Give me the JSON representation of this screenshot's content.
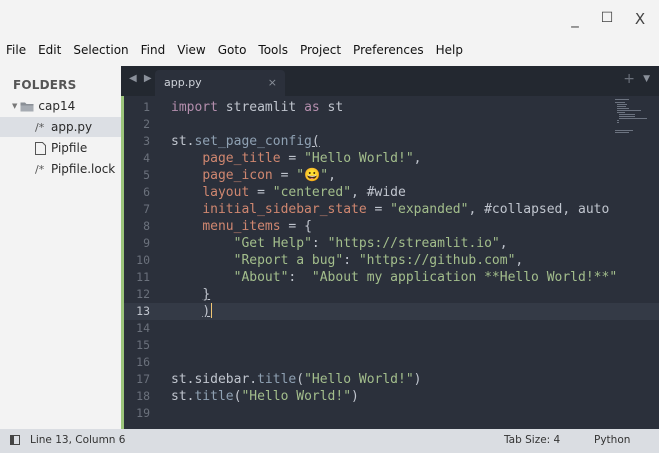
{
  "window": {
    "minimize": "_",
    "maximize": "☐",
    "close": "X"
  },
  "menu": [
    "File",
    "Edit",
    "Selection",
    "Find",
    "View",
    "Goto",
    "Tools",
    "Project",
    "Preferences",
    "Help"
  ],
  "sidebar": {
    "header": "FOLDERS",
    "folder": {
      "name": "cap14",
      "expander": "▼",
      "icon": "folder-icon"
    },
    "files": [
      {
        "prefix": "/*",
        "name": "app.py",
        "icon": "comment-file-icon",
        "selected": true
      },
      {
        "prefix": "",
        "name": "Pipfile",
        "icon": "file-icon",
        "selected": false
      },
      {
        "prefix": "/*",
        "name": "Pipfile.lock",
        "icon": "comment-file-icon",
        "selected": false
      }
    ]
  },
  "tabs": {
    "nav": "◀ ▶",
    "active": {
      "label": "app.py",
      "close": "×"
    },
    "plus": "+",
    "menu": "▼"
  },
  "editor": {
    "line_numbers": [
      "1",
      "2",
      "3",
      "4",
      "5",
      "6",
      "7",
      "8",
      "9",
      "10",
      "11",
      "12",
      "13",
      "14",
      "15",
      "16",
      "17",
      "18",
      "19"
    ],
    "current_line": 13,
    "lines": [
      {
        "k1": "import",
        "t1": " streamlit ",
        "k2": "as",
        "t2": " st"
      },
      {},
      {
        "a": "st.",
        "b": "set_page_config",
        "c": "("
      },
      {
        "p": "page_title",
        "eq": " = ",
        "s": "\"Hello World!\"",
        "e": ","
      },
      {
        "p": "page_icon",
        "eq": " = ",
        "s": "\"😀\"",
        "e": ","
      },
      {
        "p": "layout",
        "eq": " = ",
        "s": "\"centered\"",
        "e": ", #wide"
      },
      {
        "p": "initial_sidebar_state",
        "eq": " = ",
        "s": "\"expanded\"",
        "e": ", #collapsed, auto"
      },
      {
        "p": "menu_items",
        "eq": " = ",
        "e": "{"
      },
      {
        "s1": "\"Get Help\"",
        "m": ": ",
        "s2": "\"https://streamlit.io\"",
        "e": ","
      },
      {
        "s1": "\"Report a bug\"",
        "m": ": ",
        "s2": "\"https://github.com\"",
        "e": ","
      },
      {
        "s1": "\"About\"",
        "m": ":  ",
        "s2": "\"About my application **Hello World!**\""
      },
      {
        "e": "}"
      },
      {
        "e": ")"
      },
      {},
      {},
      {},
      {
        "a": "st.",
        "b": "sidebar",
        "c": ".",
        "f": "title",
        "o": "(",
        "s": "\"Hello World!\"",
        "z": ")"
      },
      {
        "a": "st.",
        "f": "title",
        "o": "(",
        "s": "\"Hello World!\"",
        "z": ")"
      },
      {}
    ]
  },
  "status": {
    "position": "Line 13, Column 6",
    "tab_size": "Tab Size: 4",
    "syntax": "Python"
  },
  "colors": {
    "editor_bg": "#2b303b",
    "keyword": "#b48ead",
    "function": "#8fa1b3",
    "param": "#d08770",
    "string": "#a3be8c",
    "gutter_modified": "#9cc57b"
  }
}
